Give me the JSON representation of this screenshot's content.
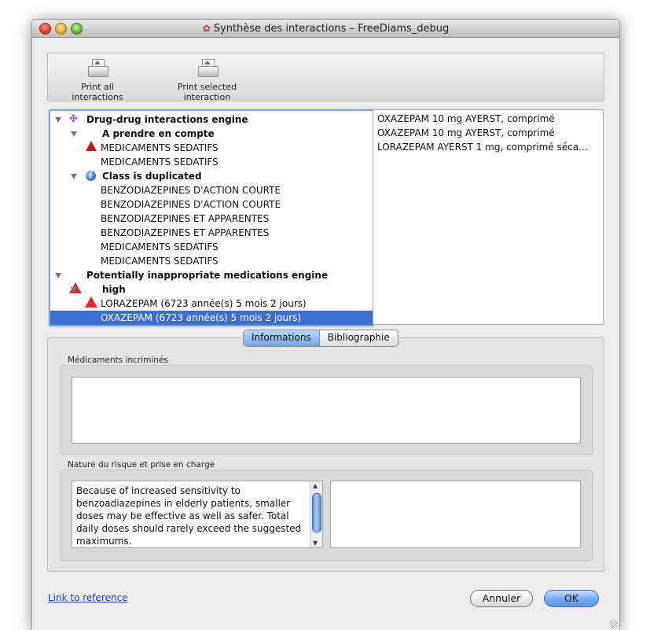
{
  "window": {
    "title": "Synthèse des interactions – FreeDiams_debug"
  },
  "toolbar": {
    "print_all_label": "Print all interactions",
    "print_selected_label": "Print selected interaction",
    "icon": "printer-icon"
  },
  "tree": {
    "ddi_engine": "Drug-drug interactions engine",
    "group_prendre": "A prendre en compte",
    "group_prendre_items": [
      "MEDICAMENTS SEDATIFS",
      "MEDICAMENTS SEDATIFS"
    ],
    "group_duplicated": "Class is duplicated",
    "group_duplicated_items": [
      "BENZODIAZEPINES D'ACTION COURTE",
      "BENZODIAZEPINES D'ACTION COURTE",
      "BENZODIAZEPINES ET APPARENTES",
      "BENZODIAZEPINES ET APPARENTES",
      "MEDICAMENTS SEDATIFS",
      "MEDICAMENTS SEDATIFS"
    ],
    "pim_engine": "Potentially inappropriate medications engine",
    "group_high": "high",
    "group_high_items": [
      "LORAZEPAM (6723 année(s) 5 mois 2 jours)",
      "OXAZEPAM (6723 année(s) 5 mois 2 jours)"
    ]
  },
  "drug_list": [
    "OXAZEPAM 10 mg AYERST, comprimé",
    "OXAZEPAM 10 mg AYERST, comprimé",
    "LORAZEPAM AYERST 1 mg, comprimé séca…"
  ],
  "tabs": [
    "Informations",
    "Bibliographie"
  ],
  "details": {
    "medicaments_title": "Médicaments incriminés",
    "risque_title": "Nature du risque et prise en charge",
    "risque_text": "Because of increased sensitivity to benzoadiazepines in elderly patients, smaller doses may be effective as well as safer. Total daily doses should rarely exceed the suggested maximums."
  },
  "footer": {
    "link": "Link to reference",
    "cancel": "Annuler",
    "ok": "OK"
  }
}
